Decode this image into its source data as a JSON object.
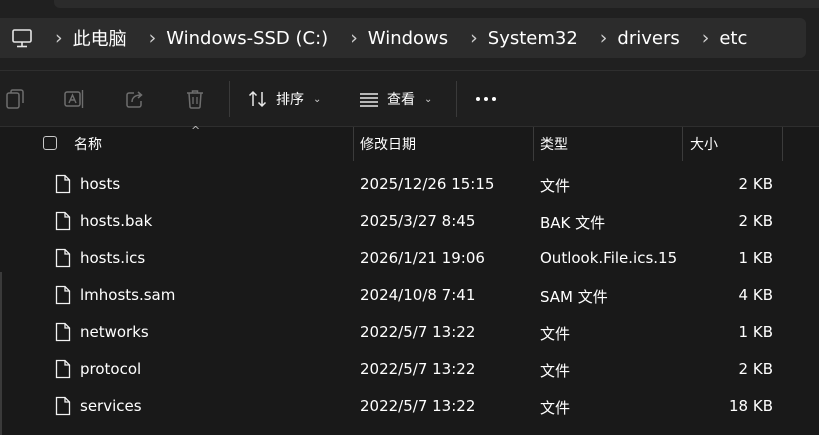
{
  "address_bar": {
    "breadcrumbs": [
      "此电脑",
      "Windows-SSD (C:)",
      "Windows",
      "System32",
      "drivers",
      "etc"
    ]
  },
  "toolbar": {
    "sort_label": "排序",
    "view_label": "查看"
  },
  "columns": {
    "name": "名称",
    "date": "修改日期",
    "type": "类型",
    "size": "大小"
  },
  "files": [
    {
      "name": "hosts",
      "date": "2025/12/26 15:15",
      "type": "文件",
      "size": "2 KB"
    },
    {
      "name": "hosts.bak",
      "date": "2025/3/27 8:45",
      "type": "BAK 文件",
      "size": "2 KB"
    },
    {
      "name": "hosts.ics",
      "date": "2026/1/21 19:06",
      "type": "Outlook.File.ics.15",
      "size": "1 KB"
    },
    {
      "name": "lmhosts.sam",
      "date": "2024/10/8 7:41",
      "type": "SAM 文件",
      "size": "4 KB"
    },
    {
      "name": "networks",
      "date": "2022/5/7 13:22",
      "type": "文件",
      "size": "1 KB"
    },
    {
      "name": "protocol",
      "date": "2022/5/7 13:22",
      "type": "文件",
      "size": "2 KB"
    },
    {
      "name": "services",
      "date": "2022/5/7 13:22",
      "type": "文件",
      "size": "18 KB"
    }
  ],
  "icons": {
    "computer": "computer-icon",
    "copy": "copy-icon",
    "rename": "rename-icon",
    "share": "share-icon",
    "delete": "delete-icon",
    "sort": "sort-icon",
    "view": "view-icon",
    "more": "more-icon",
    "file": "file-icon"
  },
  "colors": {
    "background": "#1c1c1c",
    "address_bar": "#2c2c2c",
    "text": "#ffffff"
  }
}
